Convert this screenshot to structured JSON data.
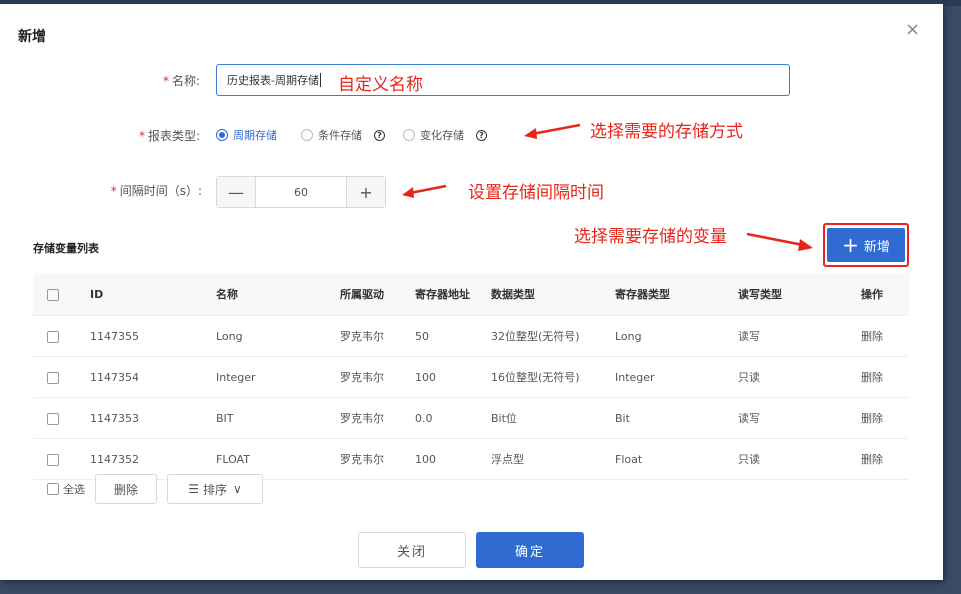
{
  "dialog": {
    "title": "新增",
    "close_glyph": "×"
  },
  "form": {
    "name_label": "名称:",
    "name_value": "历史报表-周期存储",
    "report_type_label": "报表类型:",
    "report_types": [
      "周期存储",
      "条件存储",
      "变化存储"
    ],
    "report_type_selected": "周期存储",
    "interval_label": "间隔时间（s）:",
    "interval_value": "60",
    "minus_glyph": "—",
    "plus_glyph": "+",
    "required_mark": "*",
    "help_glyph": "?"
  },
  "annotations": {
    "name": "自定义名称",
    "type": "选择需要的存储方式",
    "interval": "设置存储间隔时间",
    "variables": "选择需要存储的变量"
  },
  "section": {
    "title": "存储变量列表",
    "add_label": "新增",
    "add_glyph": "+"
  },
  "table": {
    "columns": [
      "ID",
      "名称",
      "所属驱动",
      "寄存器地址",
      "数据类型",
      "寄存器类型",
      "读写类型",
      "操作"
    ],
    "rows": [
      [
        "1147355",
        "Long",
        "罗克韦尔",
        "50",
        "32位整型(无符号)",
        "Long",
        "读写",
        "删除"
      ],
      [
        "1147354",
        "Integer",
        "罗克韦尔",
        "100",
        "16位整型(无符号)",
        "Integer",
        "只读",
        "删除"
      ],
      [
        "1147353",
        "BIT",
        "罗克韦尔",
        "0.0",
        "Bit位",
        "Bit",
        "读写",
        "删除"
      ],
      [
        "1147352",
        "FLOAT",
        "罗克韦尔",
        "100",
        "浮点型",
        "Float",
        "只读",
        "删除"
      ]
    ]
  },
  "toolbar": {
    "select_all": "全选",
    "delete": "删除",
    "sort": "排序",
    "sort_icon": "☰",
    "sort_chevron": "∨"
  },
  "footer": {
    "close": "关闭",
    "confirm": "确定"
  },
  "colors": {
    "primary": "#2f6bd1",
    "danger": "#e8251b"
  }
}
